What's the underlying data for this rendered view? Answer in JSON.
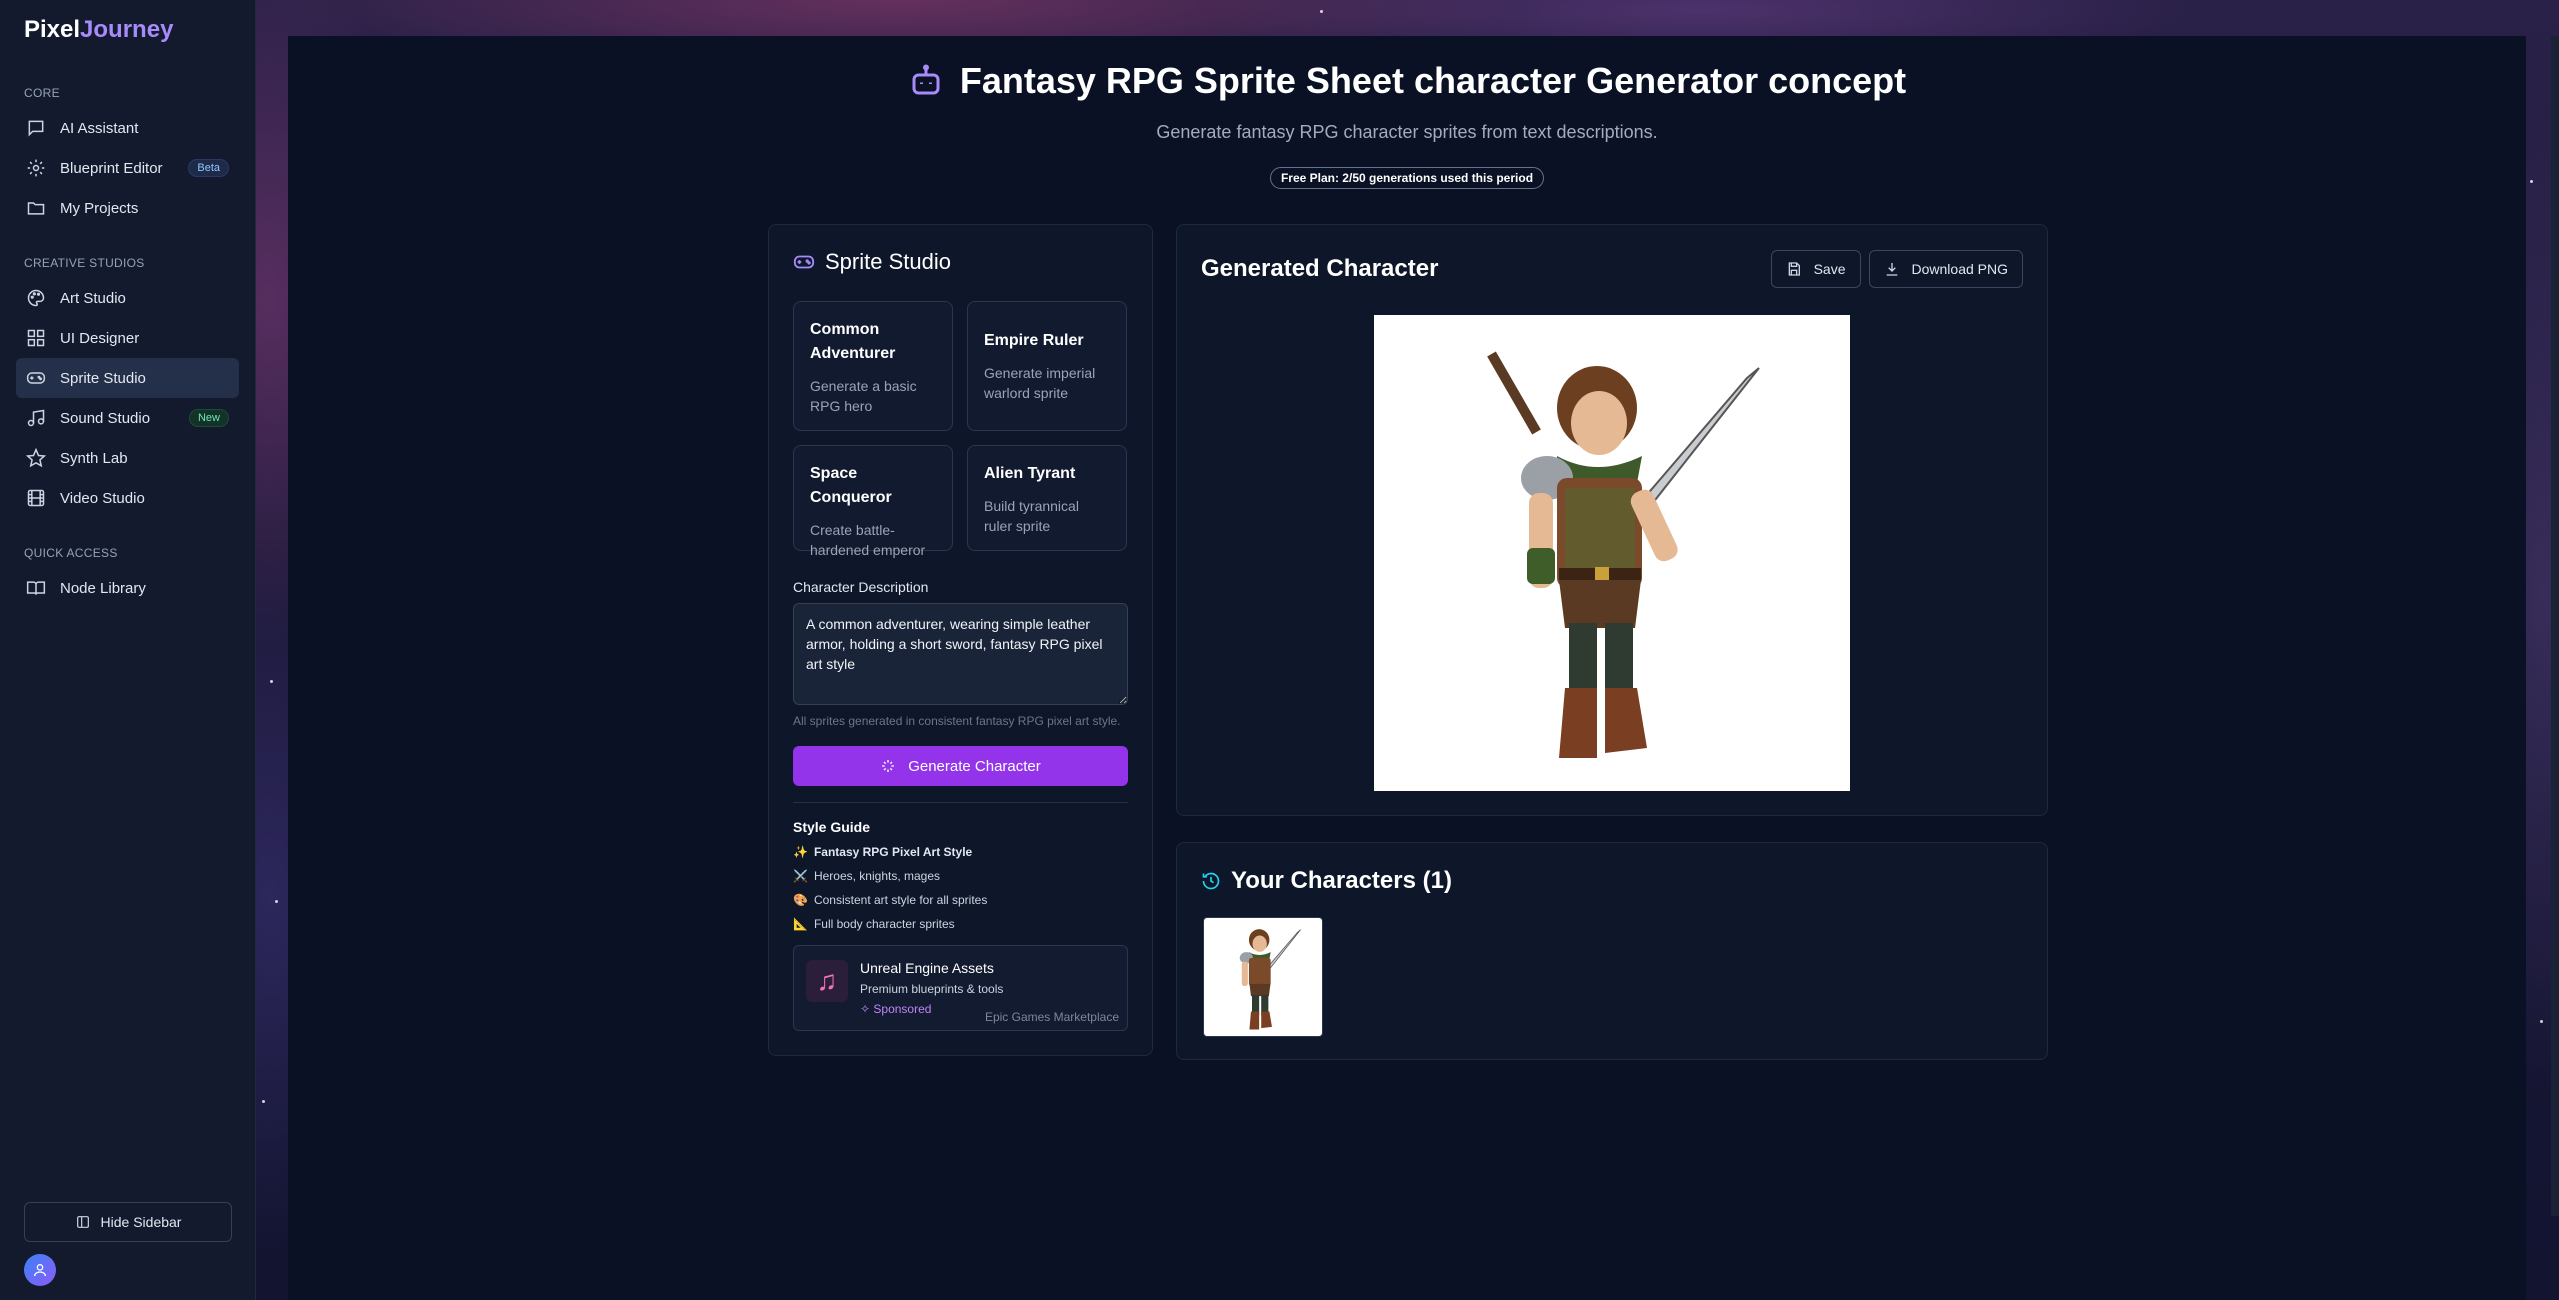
{
  "brand": {
    "name_plain": "Pixel",
    "name_accent": "Journey"
  },
  "sidebar": {
    "sections": [
      {
        "label": "CORE",
        "items": [
          {
            "label": "AI Assistant",
            "icon": "chat-icon"
          },
          {
            "label": "Blueprint Editor",
            "icon": "gear-icon",
            "badge": "Beta"
          },
          {
            "label": "My Projects",
            "icon": "folder-icon"
          }
        ]
      },
      {
        "label": "CREATIVE STUDIOS",
        "items": [
          {
            "label": "Art Studio",
            "icon": "palette-icon"
          },
          {
            "label": "UI Designer",
            "icon": "grid-icon"
          },
          {
            "label": "Sprite Studio",
            "icon": "gamepad-icon",
            "active": true
          },
          {
            "label": "Sound Studio",
            "icon": "music-note-icon",
            "badge": "New"
          },
          {
            "label": "Synth Lab",
            "icon": "star-icon"
          },
          {
            "label": "Video Studio",
            "icon": "film-icon"
          }
        ]
      },
      {
        "label": "QUICK ACCESS",
        "items": [
          {
            "label": "Node Library",
            "icon": "book-icon"
          }
        ]
      }
    ],
    "hide_label": "Hide Sidebar"
  },
  "header": {
    "title": "Fantasy RPG Sprite Sheet character Generator concept",
    "subtitle": "Generate fantasy RPG character sprites from text descriptions.",
    "plan_badge": "Free Plan: 2/50 generations used this period"
  },
  "studio": {
    "title": "Sprite Studio",
    "presets": [
      {
        "title": "Common Adventurer",
        "desc": "Generate a basic RPG hero"
      },
      {
        "title": "Empire Ruler",
        "desc": "Generate imperial warlord sprite"
      },
      {
        "title": "Space Conqueror",
        "desc": "Create battle-hardened emperor"
      },
      {
        "title": "Alien Tyrant",
        "desc": "Build tyrannical ruler sprite"
      }
    ],
    "description_label": "Character Description",
    "description_value": "A common adventurer, wearing simple leather armor, holding a short sword, fantasy RPG pixel art style",
    "hint": "All sprites generated in consistent fantasy RPG pixel art style.",
    "generate_label": "Generate Character",
    "style_guide": {
      "title": "Style Guide",
      "items": [
        {
          "emoji": "✨",
          "text": "Fantasy RPG Pixel Art Style"
        },
        {
          "emoji": "⚔️",
          "text": "Heroes, knights, mages"
        },
        {
          "emoji": "🎨",
          "text": "Consistent art style for all sprites"
        },
        {
          "emoji": "📐",
          "text": "Full body character sprites"
        }
      ]
    },
    "ad": {
      "title": "Unreal Engine Assets",
      "sub": "Premium blueprints & tools",
      "sponsored": "✧ Sponsored",
      "market": "Epic Games Marketplace"
    }
  },
  "generated": {
    "title": "Generated Character",
    "save_label": "Save",
    "download_label": "Download PNG"
  },
  "yours": {
    "title": "Your Characters (1)"
  },
  "colors": {
    "accent": "#9333ea",
    "brand_accent": "#a78bfa",
    "history": "#22d3ee"
  }
}
